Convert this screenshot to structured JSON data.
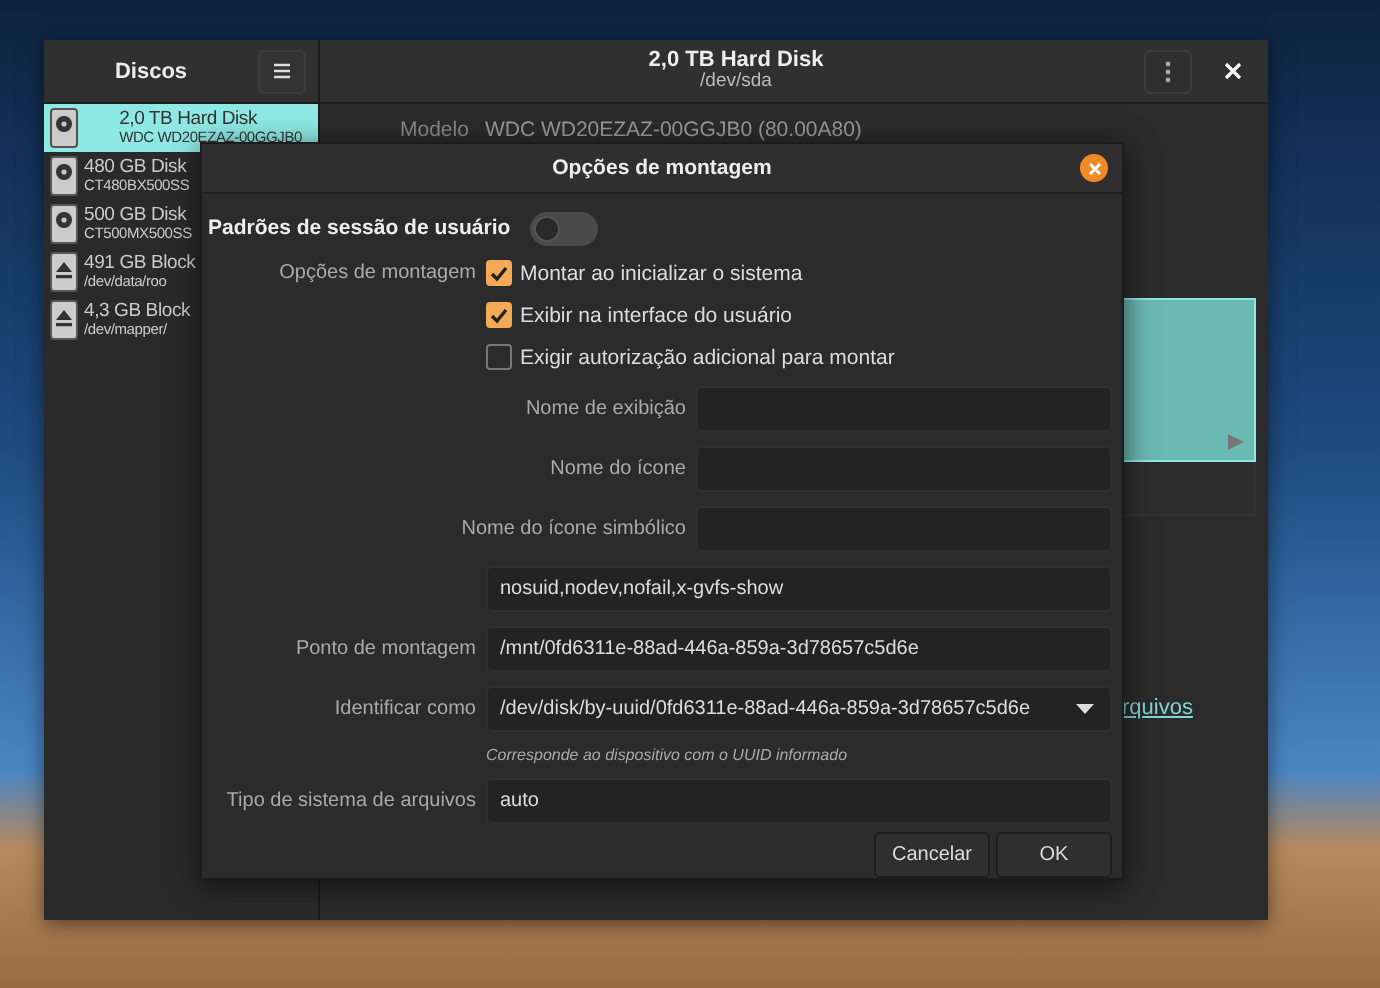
{
  "sidebar": {
    "title": "Discos",
    "items": [
      {
        "kind": "disk",
        "name": "2,0 TB Hard Disk",
        "detail": "WDC WD20EZAZ-00GGJB0",
        "selected": true
      },
      {
        "kind": "disk",
        "name": "480 GB Disk",
        "detail": "CT480BX500SS",
        "selected": false
      },
      {
        "kind": "disk",
        "name": "500 GB Disk",
        "detail": "CT500MX500SS",
        "selected": false
      },
      {
        "kind": "block",
        "name": "491 GB Block",
        "detail": "/dev/data/roo",
        "selected": false
      },
      {
        "kind": "block",
        "name": "4,3 GB Block",
        "detail": "/dev/mapper/",
        "selected": false
      }
    ]
  },
  "header": {
    "title": "2,0 TB Hard Disk",
    "subtitle": "/dev/sda"
  },
  "details": {
    "label": "Modelo",
    "value": "WDC WD20EZAZ-00GGJB0 (80.00A80)",
    "link": "rquivos"
  },
  "dialog": {
    "title": "Opções de montagem",
    "session_defaults": {
      "label": "Padrões de sessão de usuário",
      "on": false
    },
    "options_label": "Opções de montagem",
    "checkboxes": [
      {
        "label": "Montar ao inicializar o sistema",
        "checked": true
      },
      {
        "label": "Exibir na interface do usuário",
        "checked": true
      },
      {
        "label": "Exigir autorização adicional para montar",
        "checked": false
      }
    ],
    "fields": [
      {
        "kind": "short",
        "label": "Nome de exibição"
      },
      {
        "kind": "short",
        "label": "Nome do ícone"
      },
      {
        "kind": "short",
        "label": "Nome do ícone simbólico"
      },
      {
        "kind": "text",
        "value": "nosuid,nodev,nofail,x-gvfs-show"
      },
      {
        "kind": "text",
        "label": "Ponto de montagem",
        "value": "/mnt/0fd6311e-88ad-446a-859a-3d78657c5d6e"
      },
      {
        "kind": "select",
        "label": "Identificar como",
        "value": "/dev/disk/by-uuid/0fd6311e-88ad-446a-859a-3d78657c5d6e",
        "hint": "Corresponde ao dispositivo com o UUID informado"
      },
      {
        "kind": "text",
        "label": "Tipo de sistema de arquivos",
        "value": "auto"
      }
    ],
    "buttons": [
      "Cancelar",
      "OK"
    ]
  }
}
